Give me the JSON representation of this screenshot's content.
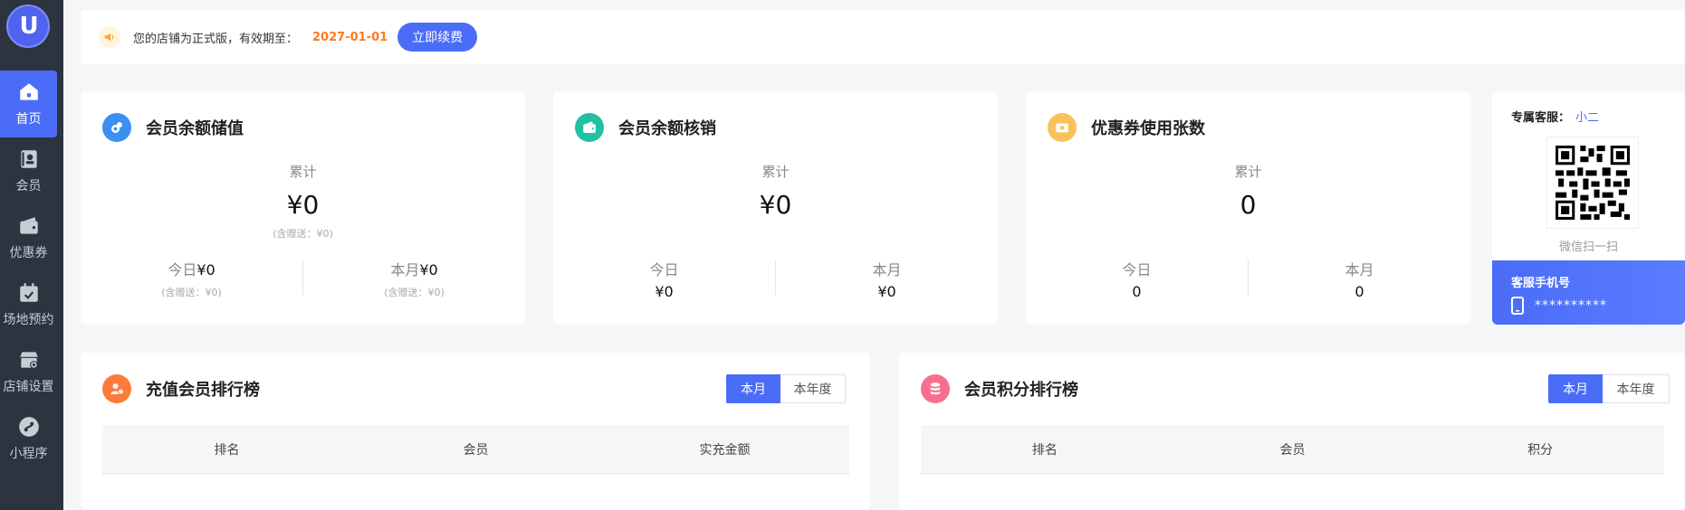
{
  "sidebar": {
    "logo_text": "U",
    "items": [
      {
        "label": "首页",
        "icon": "home-icon",
        "active": true
      },
      {
        "label": "会员",
        "icon": "member-icon",
        "active": false
      },
      {
        "label": "优惠券",
        "icon": "coupon-icon",
        "active": false
      },
      {
        "label": "场地预约",
        "icon": "calendar-icon",
        "active": false
      },
      {
        "label": "店铺设置",
        "icon": "store-settings-icon",
        "active": false
      },
      {
        "label": "小程序",
        "icon": "mini-program-icon",
        "active": false
      }
    ]
  },
  "notice": {
    "text": "您的店铺为正式版，有效期至：",
    "date": "2027-01-01",
    "button": "立即续费"
  },
  "cards": {
    "recharge": {
      "title": "会员余额储值",
      "total_label": "累计",
      "total_value": "¥0",
      "total_sub": "(含赠送：¥0)",
      "today_label": "今日",
      "today_value": "¥0",
      "today_sub": "(含赠送：¥0)",
      "month_label": "本月",
      "month_value": "¥0",
      "month_sub": "(含赠送：¥0)"
    },
    "writeoff": {
      "title": "会员余额核销",
      "total_label": "累计",
      "total_value": "¥0",
      "today_label": "今日",
      "today_value": "¥0",
      "month_label": "本月",
      "month_value": "¥0"
    },
    "coupon": {
      "title": "优惠券使用张数",
      "total_label": "累计",
      "total_value": "0",
      "today_label": "今日",
      "today_value": "0",
      "month_label": "本月",
      "month_value": "0"
    }
  },
  "service": {
    "label": "专属客服：",
    "name": "小二",
    "qr_caption": "微信扫一扫",
    "phone_label": "客服手机号",
    "phone": "**********"
  },
  "rank_recharge": {
    "title": "充值会员排行榜",
    "tab_month": "本月",
    "tab_year": "本年度",
    "columns": [
      "排名",
      "会员",
      "实充金额"
    ]
  },
  "rank_points": {
    "title": "会员积分排行榜",
    "tab_month": "本月",
    "tab_year": "本年度",
    "columns": [
      "排名",
      "会员",
      "积分"
    ]
  },
  "colors": {
    "accent": "#4a6cf7",
    "sidebar_bg": "#2c3440",
    "recharge_icon": "#3b8ff0",
    "writeoff_icon": "#1fc1a1",
    "coupon_icon": "#f8c25a",
    "rank_recharge_icon": "#ff7a3d",
    "rank_points_icon": "#f6708e",
    "date_highlight": "#ff7a1a"
  }
}
